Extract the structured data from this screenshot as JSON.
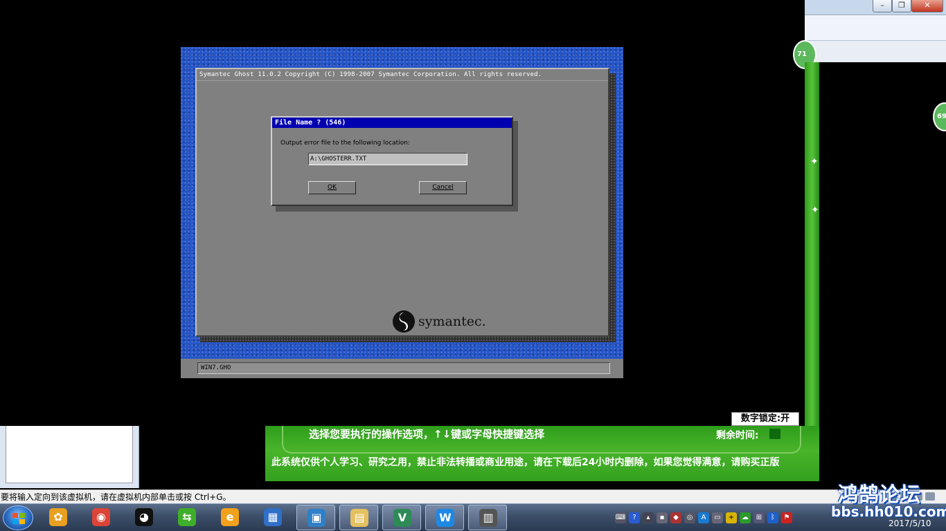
{
  "ghost": {
    "title": "Symantec Ghost 11.0.2   Copyright (C) 1998-2007 Symantec Corporation. All rights reserved.",
    "logo_text": "symantec.",
    "status_file": "WIN7.GHO"
  },
  "dialog": {
    "title": "File Name ? (546)",
    "label": "Output error file to the following location:",
    "input_value": "A:\\GHOSTERR.TXT",
    "ok_label": "OK",
    "cancel_label": "Cancel"
  },
  "boot_menu": {
    "prompt": "选择您要执行的操作选项，↑↓键或字母快捷键选择",
    "remaining_time_label": "剩余时间:",
    "notice": "此系统仅供个人学习、研究之用，禁止非法转播或商业用途，请在下载后24小时内删除，如果您觉得满意，请购买正版",
    "numlock": "数字锁定:开"
  },
  "side_badges": [
    "71",
    "69"
  ],
  "vmware_status": "要将输入定向到该虚拟机，请在虚拟机内部单击或按 Ctrl+G。",
  "taskbar": {
    "items": [
      {
        "name": "taskbar-item-pinwheel",
        "glyph": "✿",
        "color": "#e8a020"
      },
      {
        "name": "taskbar-item-chrome",
        "glyph": "◉",
        "color": "#db4437"
      },
      {
        "name": "taskbar-item-qq",
        "glyph": "◕",
        "color": "#111111"
      },
      {
        "name": "taskbar-item-360",
        "glyph": "⇆",
        "color": "#3fae2a"
      },
      {
        "name": "taskbar-item-browser",
        "glyph": "e",
        "color": "#f2a11c"
      },
      {
        "name": "taskbar-item-film",
        "glyph": "▦",
        "color": "#2f6fc8"
      },
      {
        "name": "taskbar-item-vmware",
        "glyph": "▣",
        "color": "#2f80c8"
      },
      {
        "name": "taskbar-item-explorer",
        "glyph": "▤",
        "color": "#e4c060"
      },
      {
        "name": "taskbar-item-vtool",
        "glyph": "V",
        "color": "#2e8b57"
      },
      {
        "name": "taskbar-item-wps",
        "glyph": "W",
        "color": "#1e88e5"
      },
      {
        "name": "taskbar-item-book",
        "glyph": "▥",
        "color": "#555555"
      }
    ],
    "date": "2017/5/10"
  },
  "watermark": {
    "top": "鸿鹄论坛",
    "bottom": "bbs.hh010.com"
  },
  "colors": {
    "ghost_bg": "#2454c6",
    "ghost_window": "#808080",
    "dialog_title": "#0000b0",
    "boot_green": "#3aa522"
  }
}
